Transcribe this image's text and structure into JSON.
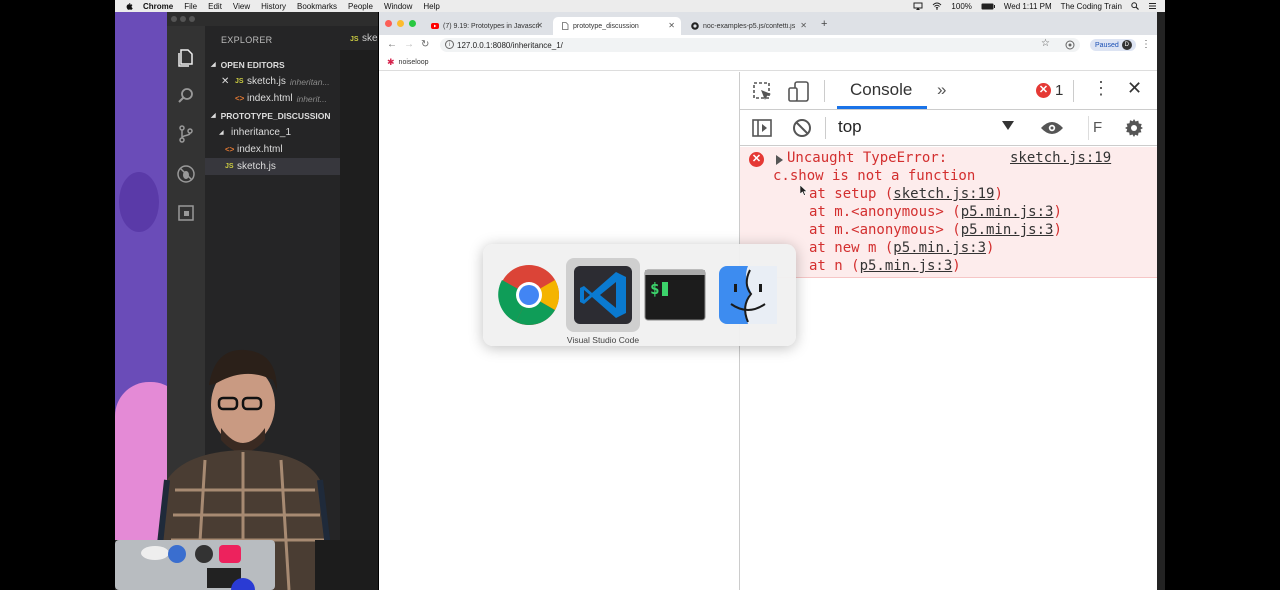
{
  "menubar": {
    "app": "Chrome",
    "items": [
      "File",
      "Edit",
      "View",
      "History",
      "Bookmarks",
      "People",
      "Window",
      "Help"
    ],
    "battery": "100%",
    "clock": "Wed 1:11 PM",
    "user": "The Coding Train"
  },
  "vscode": {
    "explorer_title": "EXPLORER",
    "tab_label": "ske",
    "open_editors_label": "OPEN EDITORS",
    "open_editors": [
      {
        "name": "sketch.js",
        "hint": "inheritan...",
        "type": "js"
      },
      {
        "name": "index.html",
        "hint": "inherit...",
        "type": "html"
      }
    ],
    "project_label": "PROTOTYPE_DISCUSSION",
    "folder": "inheritance_1",
    "files": [
      {
        "name": "index.html",
        "type": "html"
      },
      {
        "name": "sketch.js",
        "type": "js"
      }
    ],
    "badges": {
      "js": "JS",
      "html": "<>"
    }
  },
  "chrome": {
    "tabs": [
      {
        "title": "(7) 9.19: Prototypes in Javascri",
        "favicon": "youtube-icon"
      },
      {
        "title": "prototype_discussion",
        "favicon": "page-icon"
      },
      {
        "title": "noc-examples-p5.js/confetti.js",
        "favicon": "github-icon"
      }
    ],
    "url": "127.0.0.1:8080/inheritance_1/",
    "profile_status": "Paused",
    "profile_initial": "D",
    "bookmark": "noiseloop"
  },
  "devtools": {
    "panel": "Console",
    "more": "»",
    "error_count": "1",
    "context": "top",
    "filter": "F",
    "error": {
      "title": "Uncaught TypeError:",
      "location": "sketch.js:19",
      "message": "c.show is not a function",
      "stack": [
        {
          "prefix": "at setup (",
          "link": "sketch.js:19",
          "suffix": ")"
        },
        {
          "prefix": "at m.<anonymous> (",
          "link": "p5.min.js:3",
          "suffix": ")"
        },
        {
          "prefix": "at m.<anonymous> (",
          "link": "p5.min.js:3",
          "suffix": ")"
        },
        {
          "prefix": "at new m (",
          "link": "p5.min.js:3",
          "suffix": ")"
        },
        {
          "prefix": "at n (",
          "link": "p5.min.js:3",
          "suffix": ")"
        }
      ]
    }
  },
  "switcher": {
    "selected_label": "Visual Studio Code",
    "apps": [
      "chrome-icon",
      "vscode-icon",
      "terminal-icon",
      "finder-icon"
    ]
  },
  "colors": {
    "error_red": "#d32f2f",
    "error_bg": "#fdecec",
    "vscode_bg": "#1e1e1e",
    "accent_blue": "#1a73e8"
  }
}
